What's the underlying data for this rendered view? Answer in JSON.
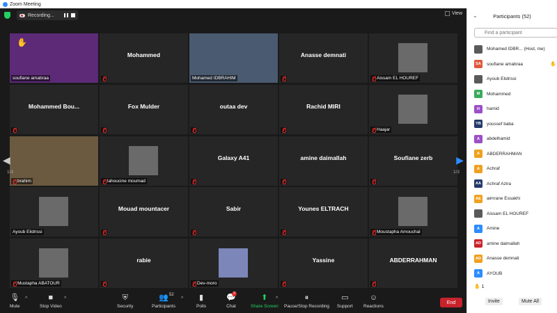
{
  "window": {
    "title": "Zoom Meeting"
  },
  "recording": {
    "label": "Recording..."
  },
  "view": {
    "label": "View"
  },
  "pages": {
    "left": "1/3",
    "right": "1/3"
  },
  "tiles": [
    {
      "label": "soufiane amabraa",
      "center": "",
      "muted": false
    },
    {
      "label": "",
      "center": "Mohammed",
      "muted": true
    },
    {
      "label": "Mohamed IDBRAHIM",
      "center": "",
      "muted": false
    },
    {
      "label": "",
      "center": "Anasse demnati",
      "muted": true
    },
    {
      "label": "Aissam EL HOUREF",
      "center": "",
      "muted": true
    },
    {
      "label": "",
      "center": "Mohammed  Bou...",
      "muted": true
    },
    {
      "label": "",
      "center": "Fox Mulder",
      "muted": true
    },
    {
      "label": "",
      "center": "outaa dev",
      "muted": true
    },
    {
      "label": "",
      "center": "Rachid MIRI",
      "muted": true
    },
    {
      "label": "Haajar",
      "center": "",
      "muted": true
    },
    {
      "label": "brahim",
      "center": "",
      "muted": true
    },
    {
      "label": "lahoucine moumad",
      "center": "",
      "muted": true
    },
    {
      "label": "",
      "center": "Galaxy A41",
      "muted": true
    },
    {
      "label": "",
      "center": "amine daimallah",
      "muted": true
    },
    {
      "label": "",
      "center": "Soufiane zerb",
      "muted": true
    },
    {
      "label": "Ayoub Elidrissi",
      "center": "",
      "muted": false
    },
    {
      "label": "",
      "center": "Mouad mountacer",
      "muted": true
    },
    {
      "label": "",
      "center": "Sabir",
      "muted": true
    },
    {
      "label": "",
      "center": "Younes ELTRACH",
      "muted": true
    },
    {
      "label": "Moustapha Amouchal",
      "center": "",
      "muted": true
    },
    {
      "label": "Mustapha ABATOUR",
      "center": "",
      "muted": true
    },
    {
      "label": "",
      "center": "rabie",
      "muted": true
    },
    {
      "label": "Dev-moro",
      "center": "",
      "muted": true
    },
    {
      "label": "",
      "center": "Yassine",
      "muted": true
    },
    {
      "label": "",
      "center": "ABDERRAHMAN",
      "muted": true
    }
  ],
  "toolbar": {
    "mute": "Mute",
    "stop_video": "Stop Video",
    "security": "Security",
    "participants": "Participants",
    "participants_count": "52",
    "polls": "Polls",
    "chat": "Chat",
    "chat_badge": "2",
    "share": "Share Screen",
    "record": "Pause/Stop Recording",
    "support": "Support",
    "reactions": "Reactions",
    "end": "End"
  },
  "panel": {
    "title": "Participants (52)",
    "search_placeholder": "Find a participant",
    "raised_count": "1",
    "invite": "Invite",
    "mute_all": "Mute All",
    "participants": [
      {
        "initials": "",
        "name": "Mohamed IDBR... (Host, me)",
        "color": "#5a5a5a",
        "photo": true
      },
      {
        "initials": "SA",
        "name": "soufiane amabraa",
        "color": "#e0573b",
        "photo": false
      },
      {
        "initials": "",
        "name": "Ayoub Elidrissi",
        "color": "#5a5a5a",
        "photo": true
      },
      {
        "initials": "M",
        "name": "Mohammed",
        "color": "#3aaa5c",
        "photo": false
      },
      {
        "initials": "H",
        "name": "hamid",
        "color": "#9b4fc9",
        "photo": false
      },
      {
        "initials": "YB",
        "name": "youssef baba",
        "color": "#243a6b",
        "photo": false
      },
      {
        "initials": "A",
        "name": "abdelhamid",
        "color": "#9b4fc9",
        "photo": false
      },
      {
        "initials": "A",
        "name": "ABDERRAHMAN",
        "color": "#f0a020",
        "photo": false
      },
      {
        "initials": "A",
        "name": "Achraf",
        "color": "#f0a020",
        "photo": false
      },
      {
        "initials": "AA",
        "name": "Achraf Azira",
        "color": "#243a6b",
        "photo": false
      },
      {
        "initials": "AE",
        "name": "aimrane Essakhi",
        "color": "#f0a020",
        "photo": false
      },
      {
        "initials": "",
        "name": "Aissam EL HOUREF",
        "color": "#5a5a5a",
        "photo": true
      },
      {
        "initials": "A",
        "name": "Amine",
        "color": "#2d8cff",
        "photo": false
      },
      {
        "initials": "AD",
        "name": "amine daimallah",
        "color": "#c8232c",
        "photo": false
      },
      {
        "initials": "AD",
        "name": "Anasse demnati",
        "color": "#f0a020",
        "photo": false
      },
      {
        "initials": "A",
        "name": "AYOUB",
        "color": "#2d8cff",
        "photo": false
      }
    ]
  }
}
